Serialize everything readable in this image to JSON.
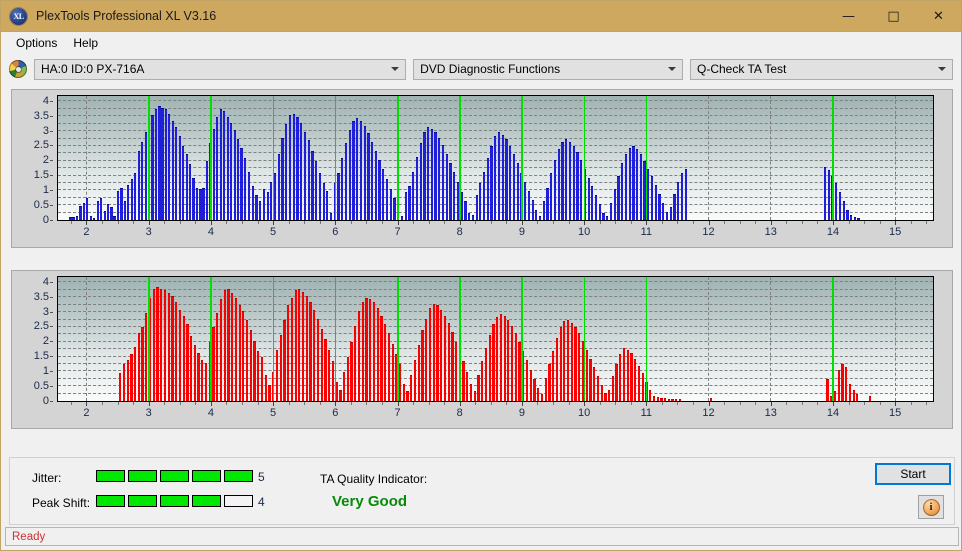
{
  "window": {
    "title": "PlexTools Professional XL V3.16",
    "app_icon": "xl-disc-icon",
    "minimize": "—",
    "maximize": "□",
    "close": "✕"
  },
  "menu": {
    "items": [
      {
        "label": "Options"
      },
      {
        "label": "Help"
      }
    ]
  },
  "toolbar": {
    "drive_icon": "optical-disc-icon",
    "drive": "HA:0 ID:0  PX-716A",
    "function": "DVD Diagnostic Functions",
    "test": "Q-Check TA Test"
  },
  "bottom": {
    "jitter_label": "Jitter:",
    "jitter_value": "5",
    "jitter_filled": 5,
    "jitter_total": 5,
    "peak_shift_label": "Peak Shift:",
    "peak_shift_value": "4",
    "peak_shift_filled": 4,
    "peak_shift_total": 5,
    "ta_quality_label": "TA Quality Indicator:",
    "ta_quality_value": "Very Good",
    "ta_quality_color": "#0a8a0a",
    "start_label": "Start",
    "info_label": "i"
  },
  "status": {
    "text": "Ready",
    "color": "#d03030"
  },
  "chart_data": [
    {
      "id": "jitter-chart",
      "type": "bar",
      "title": "",
      "xlabel": "",
      "ylabel": "",
      "color": "#1f1fdb",
      "xlim": [
        1.55,
        15.6
      ],
      "ylim": [
        0,
        4.15
      ],
      "yticks": [
        0,
        0.5,
        1,
        1.5,
        2,
        2.5,
        3,
        3.5,
        4
      ],
      "ytick_labels": [
        "0",
        "0.5",
        "1",
        "1.5",
        "2",
        "2.5",
        "3",
        "3.5",
        "4"
      ],
      "xticks": [
        2,
        3,
        4,
        5,
        6,
        7,
        8,
        9,
        10,
        11,
        12,
        13,
        14,
        15
      ],
      "xtick_labels": [
        "2",
        "3",
        "4",
        "5",
        "6",
        "7",
        "8",
        "9",
        "10",
        "11",
        "12",
        "13",
        "14",
        "15"
      ],
      "grid": true,
      "markers": [
        3,
        4,
        5,
        6,
        7,
        8,
        9,
        10,
        11,
        14
      ],
      "bar_width": 0.036,
      "x": [
        1.75,
        1.8,
        1.86,
        1.91,
        1.97,
        2.02,
        2.08,
        2.13,
        2.19,
        2.24,
        2.3,
        2.35,
        2.41,
        2.46,
        2.52,
        2.57,
        2.63,
        2.68,
        2.74,
        2.79,
        2.85,
        2.9,
        2.96,
        3.01,
        3.07,
        3.12,
        3.18,
        3.23,
        3.29,
        3.34,
        3.4,
        3.45,
        3.51,
        3.56,
        3.62,
        3.67,
        3.73,
        3.78,
        3.84,
        3.89,
        3.95,
        4.0,
        4.06,
        4.11,
        4.17,
        4.22,
        4.28,
        4.33,
        4.39,
        4.44,
        4.5,
        4.56,
        4.62,
        4.68,
        4.74,
        4.8,
        4.86,
        4.92,
        4.98,
        5.04,
        5.1,
        5.16,
        5.22,
        5.28,
        5.34,
        5.4,
        5.46,
        5.52,
        5.58,
        5.64,
        5.7,
        5.76,
        5.82,
        5.88,
        5.94,
        6.0,
        6.06,
        6.12,
        6.18,
        6.24,
        6.3,
        6.36,
        6.42,
        6.48,
        6.54,
        6.6,
        6.66,
        6.72,
        6.78,
        6.84,
        6.9,
        6.96,
        7.02,
        7.08,
        7.14,
        7.2,
        7.26,
        7.32,
        7.38,
        7.44,
        7.5,
        7.56,
        7.62,
        7.68,
        7.74,
        7.8,
        7.86,
        7.92,
        7.98,
        8.04,
        8.1,
        8.16,
        8.22,
        8.28,
        8.34,
        8.4,
        8.46,
        8.52,
        8.58,
        8.64,
        8.7,
        8.76,
        8.82,
        8.88,
        8.94,
        9.0,
        9.06,
        9.12,
        9.18,
        9.24,
        9.3,
        9.36,
        9.42,
        9.48,
        9.54,
        9.6,
        9.66,
        9.72,
        9.78,
        9.84,
        9.9,
        9.96,
        10.02,
        10.08,
        10.14,
        10.2,
        10.26,
        10.32,
        10.38,
        10.44,
        10.5,
        10.56,
        10.62,
        10.68,
        10.74,
        10.8,
        10.86,
        10.92,
        10.98,
        11.04,
        11.1,
        11.16,
        11.22,
        11.28,
        11.34,
        11.4,
        11.46,
        11.52,
        11.58,
        11.64,
        13.88,
        13.94,
        14.0,
        14.06,
        14.12,
        14.18,
        14.24,
        14.3,
        14.36,
        14.42
      ],
      "values": [
        0.08,
        0.06,
        0.1,
        0.45,
        0.55,
        0.72,
        0.1,
        0.05,
        0.62,
        0.7,
        0.28,
        0.5,
        0.4,
        0.1,
        0.95,
        1.05,
        0.6,
        1.15,
        1.35,
        1.55,
        2.3,
        2.6,
        2.95,
        3.25,
        3.5,
        3.7,
        3.8,
        3.75,
        3.7,
        3.55,
        3.3,
        3.1,
        2.8,
        2.45,
        2.2,
        1.85,
        1.4,
        1.05,
        1.0,
        1.05,
        1.95,
        2.55,
        3.05,
        3.45,
        3.7,
        3.65,
        3.45,
        3.25,
        3.0,
        2.7,
        2.4,
        2.05,
        1.6,
        1.1,
        0.8,
        0.6,
        1.0,
        0.9,
        1.25,
        1.55,
        2.2,
        2.75,
        3.2,
        3.5,
        3.55,
        3.45,
        3.25,
        2.95,
        2.65,
        2.3,
        1.95,
        1.55,
        1.2,
        0.95,
        0.2,
        1.2,
        1.55,
        2.05,
        2.55,
        3.0,
        3.3,
        3.4,
        3.3,
        3.15,
        2.9,
        2.6,
        2.3,
        2.0,
        1.7,
        1.35,
        1.0,
        0.7,
        0.25,
        0.1,
        0.9,
        1.1,
        1.6,
        2.1,
        2.55,
        2.95,
        3.1,
        3.05,
        2.95,
        2.75,
        2.5,
        2.2,
        1.9,
        1.6,
        1.25,
        0.9,
        0.6,
        0.2,
        0.15,
        0.8,
        1.2,
        1.6,
        2.05,
        2.45,
        2.8,
        2.95,
        2.85,
        2.7,
        2.45,
        2.2,
        1.9,
        1.55,
        1.25,
        0.95,
        0.65,
        0.3,
        0.1,
        0.6,
        1.05,
        1.55,
        2.0,
        2.35,
        2.6,
        2.7,
        2.6,
        2.45,
        2.25,
        2.0,
        1.7,
        1.4,
        1.1,
        0.8,
        0.5,
        0.2,
        0.1,
        0.55,
        1.0,
        1.45,
        1.9,
        2.2,
        2.4,
        2.45,
        2.35,
        2.2,
        1.95,
        1.7,
        1.45,
        1.15,
        0.85,
        0.55,
        0.25,
        0.4,
        0.85,
        1.25,
        1.55,
        1.7,
        1.75,
        1.65,
        1.45,
        1.2,
        0.9,
        0.6,
        0.3,
        0.12,
        0.08,
        0.05
      ]
    },
    {
      "id": "peak-shift-chart",
      "type": "bar",
      "title": "",
      "xlabel": "",
      "ylabel": "",
      "color": "#fa0000",
      "xlim": [
        1.55,
        15.6
      ],
      "ylim": [
        0,
        4.15
      ],
      "yticks": [
        0,
        0.5,
        1,
        1.5,
        2,
        2.5,
        3,
        3.5,
        4
      ],
      "ytick_labels": [
        "0",
        "0.5",
        "1",
        "1.5",
        "2",
        "2.5",
        "3",
        "3.5",
        "4"
      ],
      "xticks": [
        2,
        3,
        4,
        5,
        6,
        7,
        8,
        9,
        10,
        11,
        12,
        13,
        14,
        15
      ],
      "xtick_labels": [
        "2",
        "3",
        "4",
        "5",
        "6",
        "7",
        "8",
        "9",
        "10",
        "11",
        "12",
        "13",
        "14",
        "15"
      ],
      "grid": true,
      "markers": [
        3,
        4,
        5,
        6,
        7,
        8,
        9,
        10,
        11,
        14
      ],
      "bar_width": 0.036,
      "x": [
        2.55,
        2.61,
        2.67,
        2.73,
        2.79,
        2.85,
        2.91,
        2.97,
        3.03,
        3.09,
        3.15,
        3.21,
        3.27,
        3.33,
        3.39,
        3.45,
        3.51,
        3.57,
        3.63,
        3.69,
        3.75,
        3.81,
        3.87,
        3.93,
        3.99,
        4.05,
        4.11,
        4.17,
        4.23,
        4.29,
        4.35,
        4.41,
        4.47,
        4.53,
        4.59,
        4.65,
        4.71,
        4.77,
        4.83,
        4.89,
        4.95,
        5.01,
        5.07,
        5.13,
        5.19,
        5.25,
        5.31,
        5.37,
        5.43,
        5.49,
        5.55,
        5.61,
        5.67,
        5.73,
        5.79,
        5.85,
        5.91,
        5.97,
        6.03,
        6.09,
        6.15,
        6.21,
        6.27,
        6.33,
        6.39,
        6.45,
        6.51,
        6.57,
        6.63,
        6.69,
        6.75,
        6.81,
        6.87,
        6.93,
        6.99,
        7.05,
        7.11,
        7.17,
        7.23,
        7.29,
        7.35,
        7.41,
        7.47,
        7.53,
        7.59,
        7.65,
        7.71,
        7.77,
        7.83,
        7.89,
        7.95,
        8.01,
        8.07,
        8.13,
        8.19,
        8.25,
        8.31,
        8.37,
        8.43,
        8.49,
        8.55,
        8.61,
        8.67,
        8.73,
        8.79,
        8.85,
        8.91,
        8.97,
        9.03,
        9.09,
        9.15,
        9.21,
        9.27,
        9.33,
        9.39,
        9.45,
        9.51,
        9.57,
        9.63,
        9.69,
        9.75,
        9.81,
        9.87,
        9.93,
        9.99,
        10.05,
        10.11,
        10.17,
        10.23,
        10.29,
        10.35,
        10.41,
        10.47,
        10.53,
        10.59,
        10.65,
        10.71,
        10.77,
        10.83,
        10.89,
        10.95,
        11.01,
        11.07,
        11.13,
        11.19,
        11.25,
        11.31,
        11.37,
        11.43,
        11.49,
        11.55,
        12.05,
        13.92,
        13.98,
        14.04,
        14.1,
        14.16,
        14.22,
        14.28,
        14.34,
        14.4,
        14.6
      ],
      "values": [
        0.9,
        1.2,
        1.35,
        1.55,
        1.8,
        2.25,
        2.45,
        2.95,
        3.45,
        3.75,
        3.8,
        3.75,
        3.7,
        3.6,
        3.5,
        3.3,
        3.05,
        2.85,
        2.55,
        2.15,
        1.85,
        1.6,
        1.35,
        1.25,
        1.95,
        2.45,
        2.95,
        3.4,
        3.7,
        3.75,
        3.6,
        3.45,
        3.2,
        3.0,
        2.7,
        2.35,
        2.0,
        1.65,
        1.45,
        0.85,
        0.5,
        0.95,
        1.7,
        2.2,
        2.7,
        3.2,
        3.45,
        3.7,
        3.75,
        3.65,
        3.5,
        3.3,
        3.05,
        2.75,
        2.4,
        2.05,
        1.7,
        1.3,
        0.6,
        0.35,
        0.95,
        1.45,
        1.95,
        2.5,
        3.0,
        3.3,
        3.45,
        3.4,
        3.3,
        3.1,
        2.85,
        2.55,
        2.25,
        1.9,
        1.55,
        1.2,
        0.55,
        0.3,
        0.85,
        1.35,
        1.85,
        2.35,
        2.75,
        3.1,
        3.25,
        3.2,
        3.05,
        2.85,
        2.6,
        2.3,
        1.95,
        1.6,
        1.3,
        0.95,
        0.55,
        0.3,
        0.85,
        1.3,
        1.75,
        2.2,
        2.55,
        2.8,
        2.9,
        2.85,
        2.7,
        2.5,
        2.25,
        1.95,
        1.65,
        1.35,
        1.0,
        0.7,
        0.4,
        0.2,
        0.75,
        1.2,
        1.65,
        2.1,
        2.45,
        2.65,
        2.7,
        2.6,
        2.45,
        2.25,
        2.0,
        1.7,
        1.4,
        1.1,
        0.8,
        0.5,
        0.25,
        0.35,
        0.8,
        1.2,
        1.55,
        1.75,
        1.7,
        1.6,
        1.4,
        1.15,
        0.9,
        0.6,
        0.35,
        0.15,
        0.1,
        0.08,
        0.06,
        0.05,
        0.05,
        0.05,
        0.05,
        0.08,
        0.7,
        0.15,
        0.3,
        1.0,
        1.2,
        1.1,
        0.55,
        0.35,
        0.2,
        0.15
      ]
    }
  ]
}
